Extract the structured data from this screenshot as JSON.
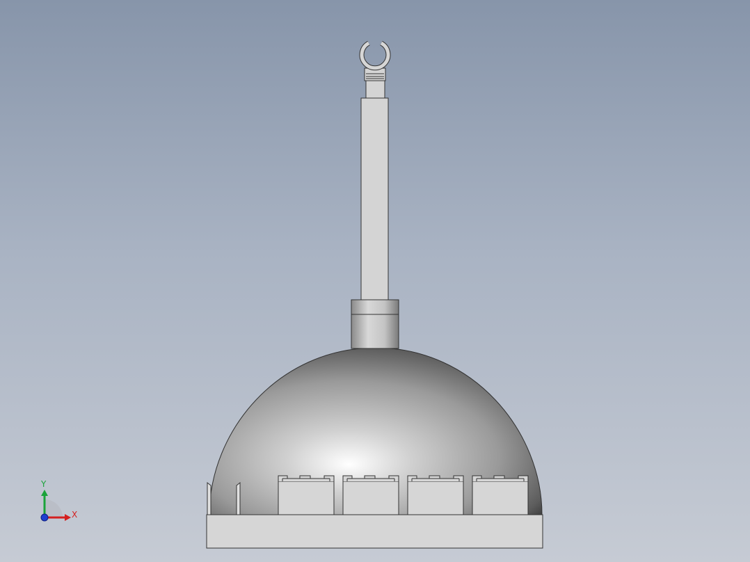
{
  "triad": {
    "y_label": "Y",
    "x_label": "X",
    "y_color": "#1aa33a",
    "x_color": "#d42020",
    "z_color": "#2040d0"
  },
  "model": {
    "background_top": "#8795aa",
    "background_bottom": "#c6cbd4",
    "part_fill": "#d6d6d6",
    "edge_color": "#333333"
  }
}
